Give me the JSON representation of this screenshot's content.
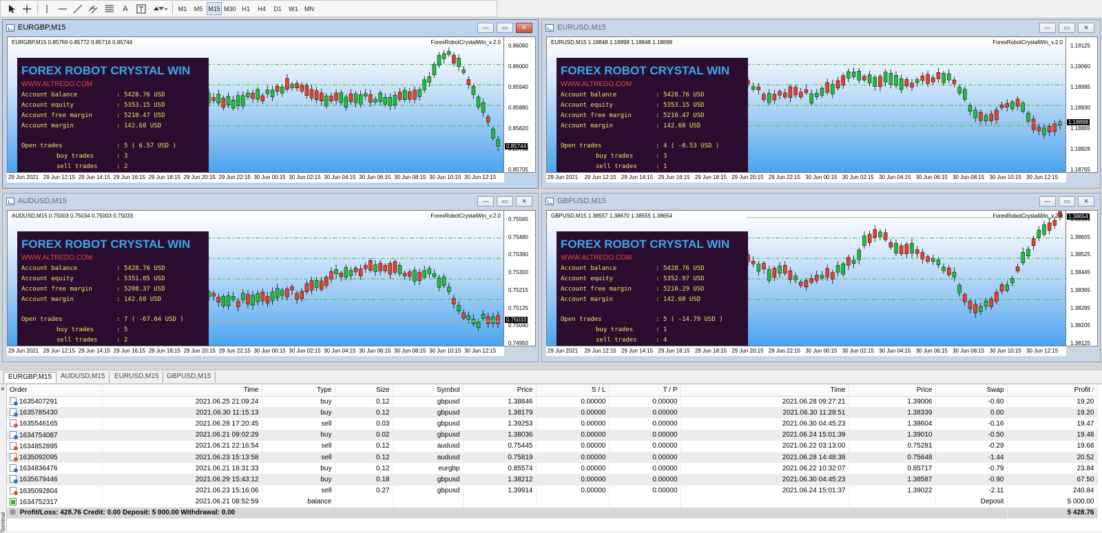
{
  "toolbar": {
    "timeframes": [
      "M1",
      "M5",
      "M15",
      "M30",
      "H1",
      "H4",
      "D1",
      "W1",
      "MN"
    ],
    "active_timeframe": "M15",
    "tools": [
      "cursor-icon",
      "crosshair-icon",
      "vertical-line-icon",
      "horizontal-line-icon",
      "trendline-icon",
      "channel-icon",
      "fibonacci-icon",
      "text-A-icon",
      "text-label-icon",
      "arrows-icon"
    ]
  },
  "panel": {
    "title": "FOREX ROBOT CRYSTAL WIN",
    "url": "WWW.ALTREDO.COM",
    "label_balance": "Account balance",
    "label_equity": "Account equity",
    "label_free_margin": "Account free margin",
    "label_margin": "Account margin",
    "label_open": "Open trades",
    "label_buy": "buy trades",
    "label_sell": "sell trades",
    "colon": ":",
    "indicator_name": "ForexRobotCrystalWin_v.2.0"
  },
  "charts": [
    {
      "title": "EURGBP,M15",
      "header": "EURGBP,M15  0.85769 0.85772 0.85716 0.85744",
      "indicator": "ForexRobotCrystalWin_v.2.0",
      "price_ticks": [
        "0.86060",
        "0.86000",
        "0.85940",
        "0.85880",
        "0.85820",
        "0.85760",
        "0.85705"
      ],
      "current_price": "0.85744",
      "time_ticks": [
        "29 Jun 2021",
        "29 Jun 12:15",
        "29 Jun 14:15",
        "29 Jun 16:15",
        "29 Jun 18:15",
        "29 Jun 20:15",
        "29 Jun 22:15",
        "30 Jun 00:15",
        "30 Jun 02:15",
        "30 Jun 04:15",
        "30 Jun 06:15",
        "30 Jun 08:15",
        "30 Jun 10:15",
        "30 Jun 12:15"
      ],
      "balance": "5428.76 USD",
      "equity": "5353.15 USD",
      "free_margin": "5210.47 USD",
      "margin": "142.68 USD",
      "open_trades": "5 ( 6.57 USD )",
      "buy_trades": "3",
      "sell_trades": "2"
    },
    {
      "title": "EURUSD,M15",
      "header": "EURUSD,M15  1.18848 1.18898 1.18848 1.18898",
      "indicator": "ForexRobotCrystalWin_v.2.0",
      "price_ticks": [
        "1.19125",
        "1.19060",
        "1.18995",
        "1.18930",
        "1.18865",
        "1.18828",
        "1.18765"
      ],
      "current_price": "1.18898",
      "time_ticks": [
        "29 Jun 2021",
        "29 Jun 12:15",
        "29 Jun 14:15",
        "29 Jun 16:15",
        "29 Jun 18:15",
        "29 Jun 20:15",
        "29 Jun 22:15",
        "30 Jun 00:15",
        "30 Jun 02:15",
        "30 Jun 04:15",
        "30 Jun 06:15",
        "30 Jun 08:15",
        "30 Jun 10:15",
        "30 Jun 12:15"
      ],
      "balance": "5428.76 USD",
      "equity": "5353.15 USD",
      "free_margin": "5210.47 USD",
      "margin": "142.68 USD",
      "open_trades": "4 ( -0.53 USD )",
      "buy_trades": "3",
      "sell_trades": "1"
    },
    {
      "title": "AUDUSD,M15",
      "header": "AUDUSD,M15  0.75003 0.75034 0.75003 0.75033",
      "indicator": "ForexRobotCrystalWin_v.2.0",
      "price_ticks": [
        "0.75565",
        "0.75480",
        "0.75390",
        "0.75300",
        "0.75215",
        "0.75125",
        "0.75040",
        "0.74950"
      ],
      "current_price": "0.75033",
      "time_ticks": [
        "29 Jun 2021",
        "29 Jun 12:15",
        "29 Jun 14:15",
        "29 Jun 16:15",
        "29 Jun 18:15",
        "29 Jun 20:15",
        "29 Jun 22:15",
        "30 Jun 00:15",
        "30 Jun 02:15",
        "30 Jun 04:15",
        "30 Jun 06:15",
        "30 Jun 08:15",
        "30 Jun 10:15",
        "30 Jun 12:15"
      ],
      "balance": "5428.76 USD",
      "equity": "5351.05 USD",
      "free_margin": "5208.37 USD",
      "margin": "142.68 USD",
      "open_trades": "7 ( -67.04 USD )",
      "buy_trades": "5",
      "sell_trades": "2"
    },
    {
      "title": "GBPUSD,M15",
      "header": "GBPUSD,M15  1.38557 1.38670 1.38555 1.38654",
      "indicator": "ForexRobotCrystalWin_v.2.0",
      "price_ticks": [
        "1.38685",
        "1.38605",
        "1.38525",
        "1.38445",
        "1.38365",
        "1.38285",
        "1.38205",
        "1.38125"
      ],
      "current_price": "1.38654",
      "time_ticks": [
        "29 Jun 2021",
        "29 Jun 12:15",
        "29 Jun 14:15",
        "29 Jun 16:15",
        "29 Jun 18:15",
        "29 Jun 20:15",
        "29 Jun 22:15",
        "30 Jun 00:15",
        "30 Jun 02:15",
        "30 Jun 04:15",
        "30 Jun 06:15",
        "30 Jun 08:15",
        "30 Jun 10:15",
        "30 Jun 12:15"
      ],
      "balance": "5428.76 USD",
      "equity": "5352.97 USD",
      "free_margin": "5210.29 USD",
      "margin": "142.68 USD",
      "open_trades": "5 ( -14.79 USD )",
      "buy_trades": "1",
      "sell_trades": "4"
    }
  ],
  "window_tabs": [
    "EURGBP,M15",
    "AUDUSD,M15",
    "EURUSD,M15",
    "GBPUSD,M15"
  ],
  "active_window_tab": "EURGBP,M15",
  "terminal": {
    "side_label": "Terminal",
    "close_glyph": "×",
    "columns": [
      "Order",
      "Time",
      "Type",
      "Size",
      "Symbol",
      "Price",
      "S / L",
      "T / P",
      "Time",
      "Price",
      "Swap",
      "Profit"
    ],
    "sort_indicator": "/",
    "rows": [
      {
        "order": "1635407291",
        "open_time": "2021.06.25 21:09:24",
        "type": "buy",
        "size": "0.12",
        "symbol": "gbpusd",
        "open_price": "1.38846",
        "sl": "0.00000",
        "tp": "0.00000",
        "close_time": "2021.06.28 09:27:21",
        "close_price": "1.39006",
        "swap": "-0.60",
        "profit": "19.20"
      },
      {
        "order": "1635785430",
        "open_time": "2021.06.30 11:15:13",
        "type": "buy",
        "size": "0.12",
        "symbol": "gbpusd",
        "open_price": "1.38179",
        "sl": "0.00000",
        "tp": "0.00000",
        "close_time": "2021.06.30 11:28:51",
        "close_price": "1.38339",
        "swap": "0.00",
        "profit": "19.20"
      },
      {
        "order": "1635546165",
        "open_time": "2021.06.28 17:20:45",
        "type": "sell",
        "size": "0.03",
        "symbol": "gbpusd",
        "open_price": "1.39253",
        "sl": "0.00000",
        "tp": "0.00000",
        "close_time": "2021.06.30 04:45:23",
        "close_price": "1.38604",
        "swap": "-0.16",
        "profit": "19.47"
      },
      {
        "order": "1634754087",
        "open_time": "2021.06.21 09:02:29",
        "type": "buy",
        "size": "0.02",
        "symbol": "gbpusd",
        "open_price": "1.38036",
        "sl": "0.00000",
        "tp": "0.00000",
        "close_time": "2021.06.24 15:01:39",
        "close_price": "1.39010",
        "swap": "-0.50",
        "profit": "19.48"
      },
      {
        "order": "1634852895",
        "open_time": "2021.06.21 22:16:54",
        "type": "sell",
        "size": "0.12",
        "symbol": "audusd",
        "open_price": "0.75445",
        "sl": "0.00000",
        "tp": "0.00000",
        "close_time": "2021.06.22 03:13:00",
        "close_price": "0.75281",
        "swap": "-0.29",
        "profit": "19.68"
      },
      {
        "order": "1635092095",
        "open_time": "2021.06.23 15:13:58",
        "type": "sell",
        "size": "0.12",
        "symbol": "audusd",
        "open_price": "0.75819",
        "sl": "0.00000",
        "tp": "0.00000",
        "close_time": "2021.06.28 14:48:38",
        "close_price": "0.75648",
        "swap": "-1.44",
        "profit": "20.52"
      },
      {
        "order": "1634836476",
        "open_time": "2021.06.21 18:31:33",
        "type": "buy",
        "size": "0.12",
        "symbol": "eurgbp",
        "open_price": "0.85574",
        "sl": "0.00000",
        "tp": "0.00000",
        "close_time": "2021.06.22 10:32:07",
        "close_price": "0.85717",
        "swap": "-0.79",
        "profit": "23.84"
      },
      {
        "order": "1635679446",
        "open_time": "2021.06.29 15:43:12",
        "type": "buy",
        "size": "0.18",
        "symbol": "gbpusd",
        "open_price": "1.38212",
        "sl": "0.00000",
        "tp": "0.00000",
        "close_time": "2021.06.30 04:45:23",
        "close_price": "1.38587",
        "swap": "-0.90",
        "profit": "67.50"
      },
      {
        "order": "1635092804",
        "open_time": "2021.06.23 15:16:06",
        "type": "sell",
        "size": "0.27",
        "symbol": "gbpusd",
        "open_price": "1.39914",
        "sl": "0.00000",
        "tp": "0.00000",
        "close_time": "2021.06.24 15:01:37",
        "close_price": "1.39022",
        "swap": "-2.11",
        "profit": "240.84"
      }
    ],
    "balance_row": {
      "order": "1634752317",
      "time": "2021.06.21 08:52:59",
      "type": "balance",
      "comment": "Deposit",
      "profit": "5 000.00"
    },
    "summary": {
      "text": "Profit/Loss: 428.76  Credit: 0.00  Deposit: 5 000.00  Withdrawal: 0.00",
      "total": "5 428.76"
    }
  },
  "colors": {
    "bull": "#1fbf3a",
    "bear": "#e8412c",
    "level_line": "#37c03a",
    "panel_bg": "#2b0d2f",
    "panel_title": "#3aa9ee",
    "panel_text": "#f1e66a",
    "panel_url": "#e24a4a"
  }
}
